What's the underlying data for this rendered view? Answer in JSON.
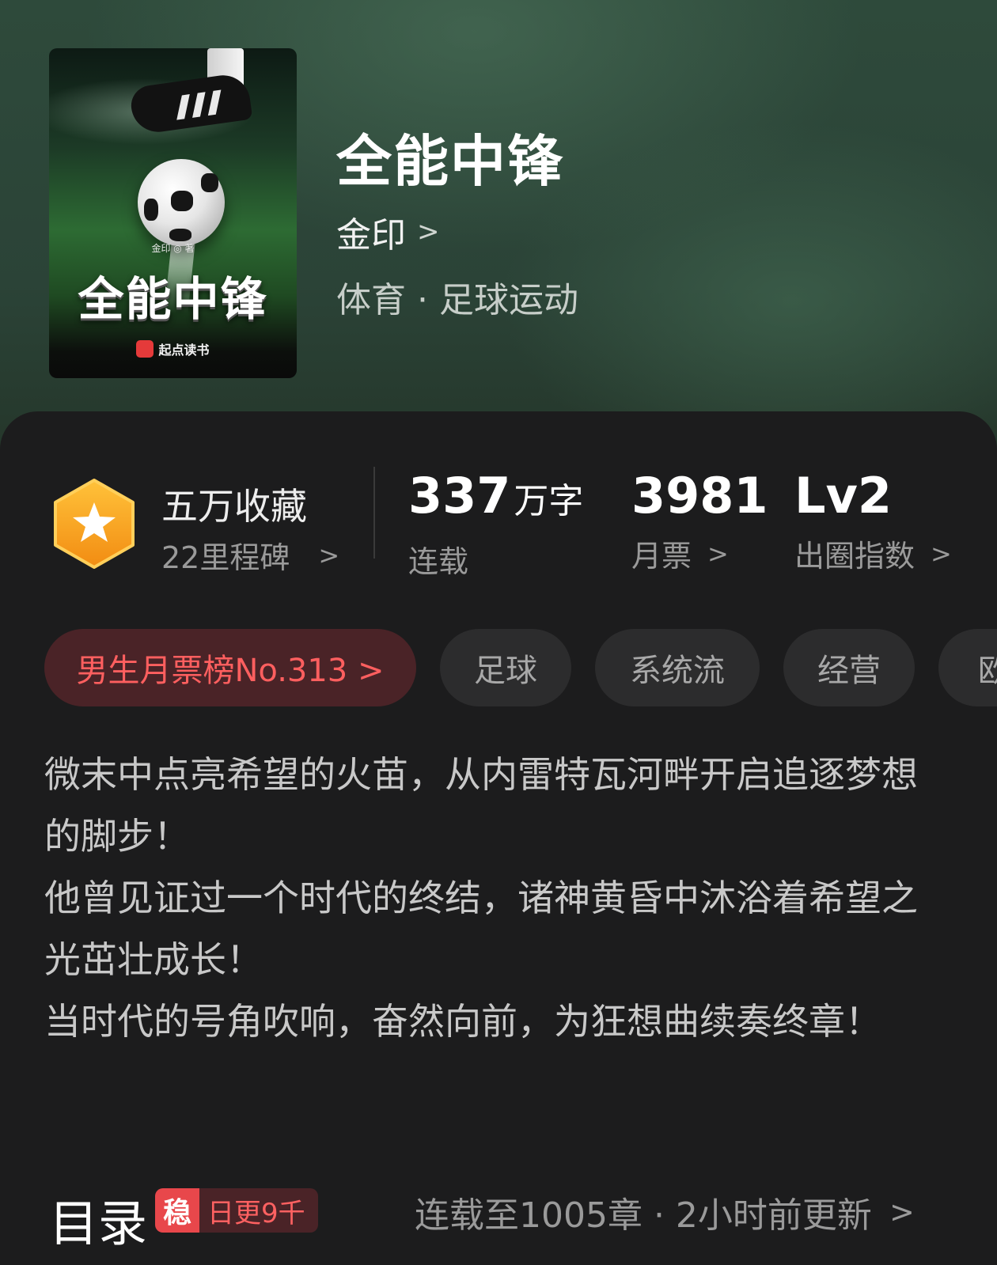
{
  "book": {
    "title": "全能中锋",
    "author": "金印",
    "genre": "体育 · 足球运动",
    "cover": {
      "author_line": "金印 ◎ 著",
      "title": "全能中锋",
      "brand": "起点读书"
    }
  },
  "stats": {
    "favorites": {
      "title": "五万收藏",
      "sub": "22里程碑"
    },
    "words": {
      "value": "337",
      "unit": "万字",
      "label": "连载"
    },
    "monthly": {
      "value": "3981",
      "label": "月票"
    },
    "circle": {
      "value": "Lv2",
      "label": "出圈指数"
    }
  },
  "tags": [
    "男生月票榜No.313 >",
    "足球",
    "系统流",
    "经营",
    "欧"
  ],
  "description": [
    "微末中点亮希望的火苗，从内雷特瓦河畔开启追逐梦想的脚步！",
    "他曾见证过一个时代的终结，诸神黄昏中沐浴着希望之光茁壮成长！",
    "当时代的号角吹响，奋然向前，为狂想曲续奏终章！"
  ],
  "toc": {
    "title": "目录",
    "badge_icon": "稳",
    "badge_text": "日更9千",
    "status": "连载至1005章 · 2小时前更新"
  },
  "colors": {
    "accent_red": "#ff5f5f",
    "badge_orange": "#f7a21b",
    "panel_bg": "#1c1c1d"
  },
  "icons": [
    "star-hexagon-icon",
    "chevron-right-icon"
  ]
}
